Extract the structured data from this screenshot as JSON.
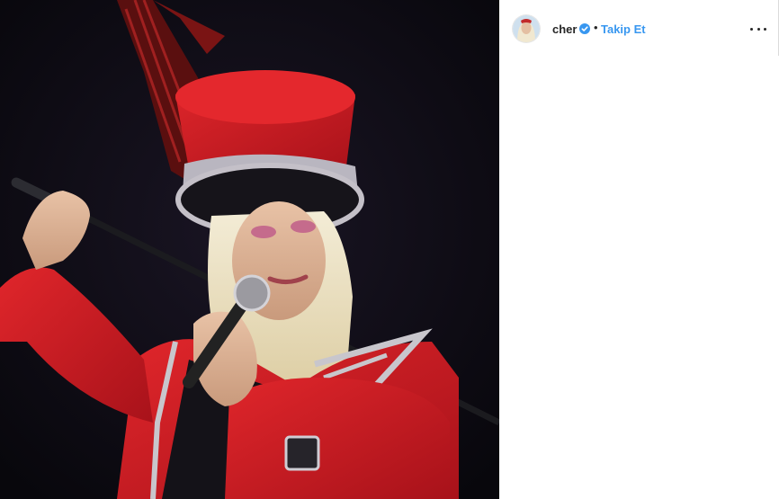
{
  "post": {
    "author": {
      "username": "cher",
      "verified": true,
      "avatar_icon": "profile-avatar"
    },
    "separator": "•",
    "follow_label": "Takip Et",
    "more_icon": "more-options-icon",
    "media": {
      "kind": "photo"
    }
  },
  "colors": {
    "follow_blue": "#3897f0",
    "verified_blue": "#3897f0",
    "text_dark": "#262626"
  }
}
